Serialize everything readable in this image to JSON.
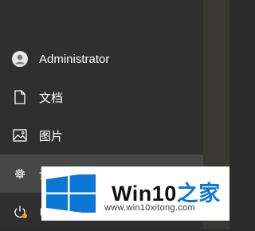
{
  "start_menu": {
    "user": {
      "name": "Administrator",
      "icon": "user-avatar-icon"
    },
    "items": [
      {
        "label": "文档",
        "icon": "document-icon"
      },
      {
        "label": "图片",
        "icon": "pictures-icon"
      },
      {
        "label": "设置",
        "icon": "gear-icon",
        "visible_text": "设",
        "active": true
      },
      {
        "label": "电源",
        "icon": "power-icon",
        "visible_text": "电"
      }
    ]
  },
  "watermark": {
    "title_latin": "Win10",
    "title_cn": "之家",
    "url": "www.win10xitong.com",
    "colors": {
      "flag": "#0a78d4",
      "cn_text": "#0a78d4",
      "badge": "#ff9a1f"
    }
  },
  "colors": {
    "menu_background": "#2f2f2f",
    "active_item": "#474747",
    "text": "#ffffff"
  }
}
